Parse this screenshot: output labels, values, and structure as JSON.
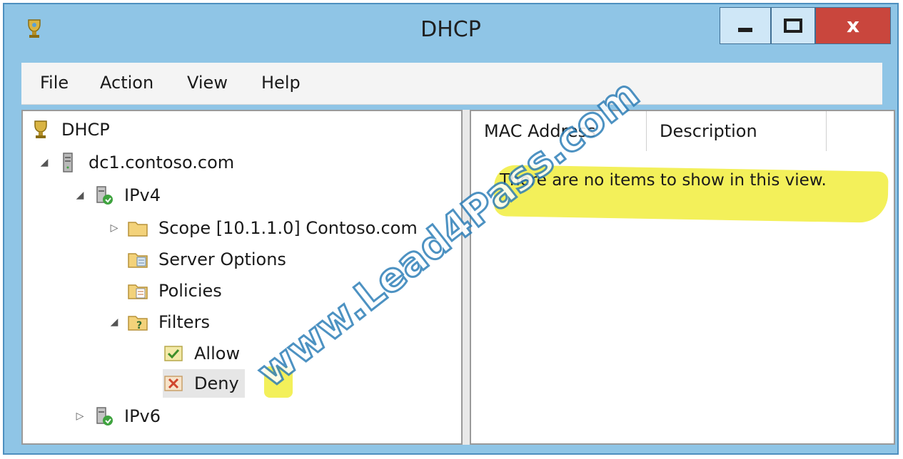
{
  "window": {
    "title": "DHCP",
    "close_glyph": "x",
    "accent": "#8fc5e6",
    "close_color": "#c9463d"
  },
  "menu": [
    "File",
    "Action",
    "View",
    "Help"
  ],
  "tree": {
    "root": "DHCP",
    "server": "dc1.contoso.com",
    "ipv4": "IPv4",
    "scope": "Scope [10.1.1.0] Contoso.com",
    "server_options": "Server Options",
    "policies": "Policies",
    "filters": "Filters",
    "allow": "Allow",
    "deny": "Deny",
    "ipv6": "IPv6"
  },
  "list": {
    "columns": [
      "MAC Address",
      "Description"
    ],
    "empty_message": "There are no items to show in this view."
  },
  "watermark": "www.Lead4Pass.com",
  "icons": {
    "app": "dhcp-icon",
    "root": "dhcp-icon",
    "server": "server-icon",
    "ipv4": "ipv4-icon",
    "scope": "folder-icon",
    "server_options": "server-options-icon",
    "policies": "policies-icon",
    "filters": "filters-icon",
    "allow": "allow-check-icon",
    "deny": "deny-x-icon",
    "ipv6": "ipv6-icon"
  },
  "highlight_color": "#f3f05a"
}
